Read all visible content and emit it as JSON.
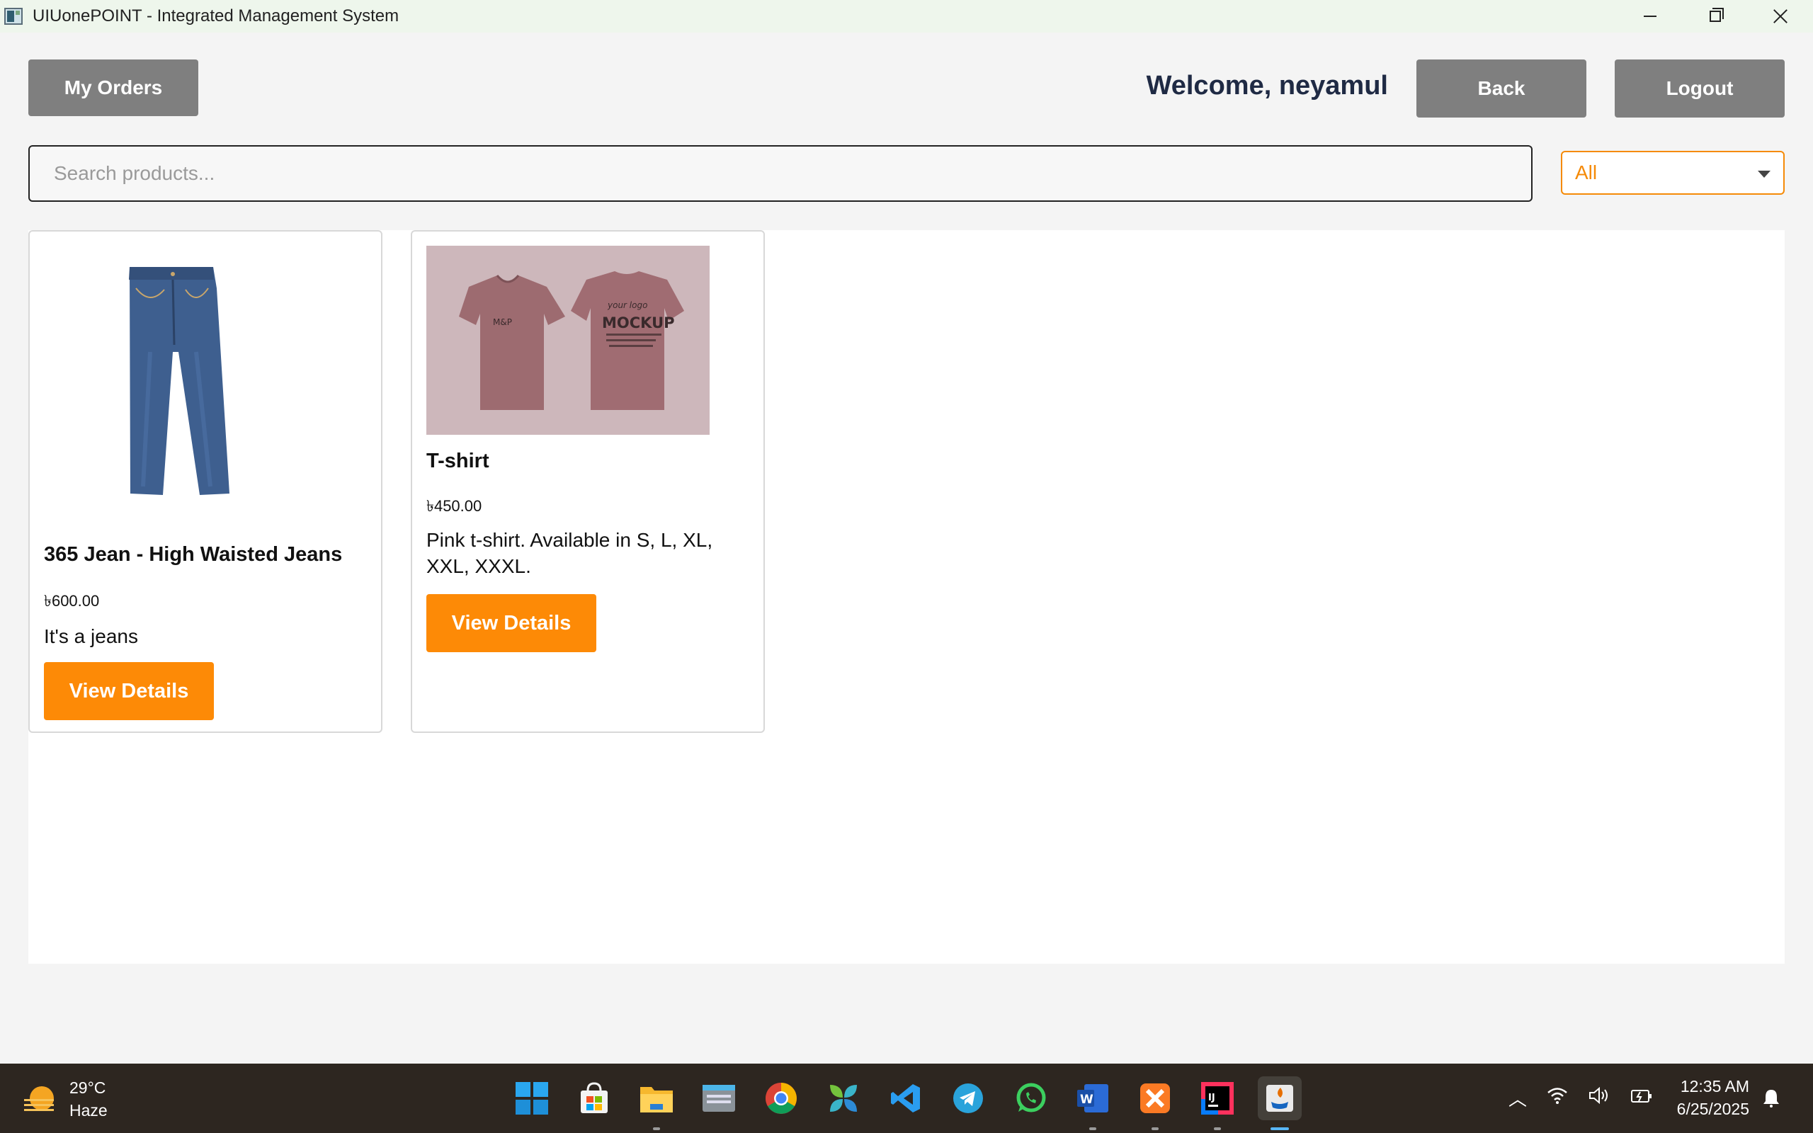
{
  "window": {
    "title": "UIUonePOINT - Integrated Management System",
    "controls": [
      "minimize-icon",
      "maximize-icon",
      "close-icon"
    ]
  },
  "header": {
    "my_orders_label": "My Orders",
    "welcome_text": "Welcome, neyamul",
    "back_label": "Back",
    "logout_label": "Logout"
  },
  "search": {
    "placeholder": "Search products...",
    "value": ""
  },
  "filter": {
    "selected": "All",
    "accent_color": "#f58a07"
  },
  "products": [
    {
      "name": "365 Jean - High Waisted Jeans",
      "price": "৳600.00",
      "description": "It's a jeans",
      "button_label": "View Details",
      "image_icon": "jeans-image"
    },
    {
      "name": "T-shirt",
      "price": "৳450.00",
      "description": "Pink t-shirt. Available in S, L, XL, XXL, XXXL.",
      "button_label": "View Details",
      "image_icon": "tshirt-mockup-image",
      "image_print_text": "MOCKUP"
    }
  ],
  "colors": {
    "primary_button": "#fd8a06",
    "secondary_button": "#7f7f7f",
    "welcome_text": "#1f2a44"
  },
  "taskbar": {
    "weather_temp": "29°C",
    "weather_desc": "Haze",
    "time": "12:35 AM",
    "date": "6/25/2025",
    "apps": [
      "start-icon",
      "store-icon",
      "file-explorer-icon",
      "keyboard-app-icon",
      "chrome-icon",
      "app-icon",
      "vscode-icon",
      "telegram-icon",
      "whatsapp-icon",
      "word-icon",
      "xampp-icon",
      "intellij-icon",
      "java-icon"
    ]
  }
}
